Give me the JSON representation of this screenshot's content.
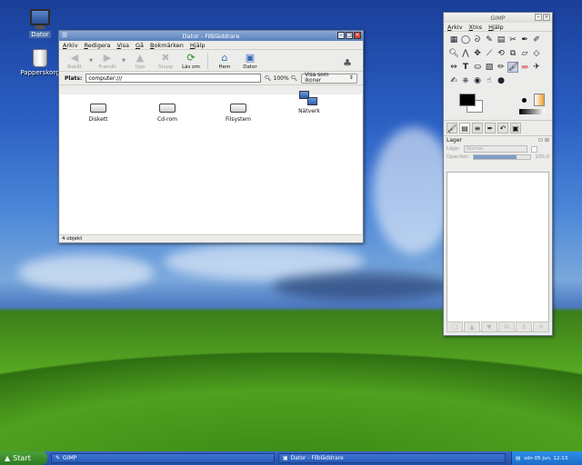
{
  "desktop": {
    "icons": [
      {
        "label": "Dator",
        "icon": "computer-icon"
      },
      {
        "label": "Papperskorg",
        "icon": "trash-icon"
      }
    ]
  },
  "file_manager": {
    "title": "Dator - Filbläddrare",
    "menu": [
      "Arkiv",
      "Redigera",
      "Visa",
      "Gå",
      "Bokmärken",
      "Hjälp"
    ],
    "toolbar": [
      {
        "label": "Bakåt",
        "icon": "back-arrow-icon",
        "enabled": false
      },
      {
        "label": "Framåt",
        "icon": "forward-arrow-icon",
        "enabled": false
      },
      {
        "label": "Upp",
        "icon": "up-arrow-icon",
        "enabled": false
      },
      {
        "label": "Stopp",
        "icon": "stop-icon",
        "enabled": false
      },
      {
        "label": "Läs om",
        "icon": "reload-icon",
        "enabled": true
      },
      {
        "label": "Hem",
        "icon": "home-icon",
        "enabled": true
      },
      {
        "label": "Dator",
        "icon": "computer-icon",
        "enabled": true
      }
    ],
    "location_label": "Plats:",
    "location_value": "computer:///",
    "zoom": "100%",
    "view_mode": "Visa som ikoner",
    "items": [
      {
        "label": "Diskett",
        "icon": "floppy-drive-icon"
      },
      {
        "label": "Cd-rom",
        "icon": "cdrom-drive-icon"
      },
      {
        "label": "Filsystem",
        "icon": "filesystem-drive-icon"
      },
      {
        "label": "Nätverk",
        "icon": "network-icon"
      }
    ],
    "status": "4 objekt"
  },
  "gimp": {
    "title": "GIMP",
    "menu": [
      "Arkiv",
      "Xtns",
      "Hjälp"
    ],
    "layers_title": "Lager",
    "mode_label": "Läge:",
    "mode_value": "Normal",
    "opacity_label": "Opacitet:",
    "opacity_value": "100,0"
  },
  "taskbar": {
    "start_label": "Start",
    "tasks": [
      "GIMP",
      "Dator - Filbläddrare"
    ],
    "clock": "sön 05 jun, 12:13"
  }
}
